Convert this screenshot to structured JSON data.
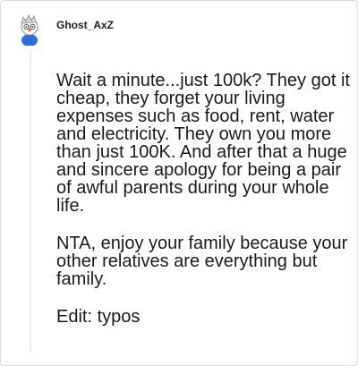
{
  "comment": {
    "username": "Ghost_AxZ",
    "avatar_icon": "snoo-avatar-icon",
    "paragraphs": [
      "Wait a minute...just 100k? They got it cheap, they forget your living expenses such as food, rent, water and electricity. They own you more than just 100K. And after that a huge and sincere apology for being a pair of awful parents during your whole life.",
      "NTA, enjoy your family because your other relatives are everything but family.",
      "Edit: typos"
    ]
  },
  "colors": {
    "avatar_body": "#2f6fd6",
    "avatar_face": "#ffffff",
    "thread_line": "#ededed"
  }
}
